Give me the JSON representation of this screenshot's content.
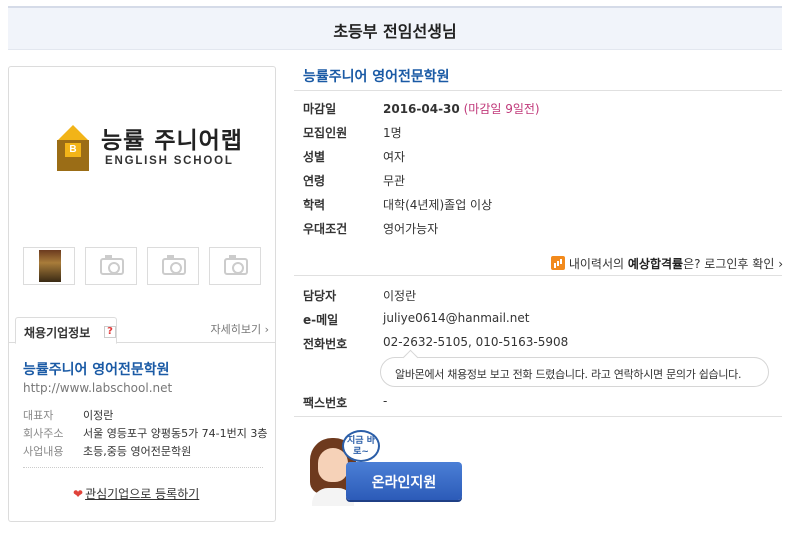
{
  "page_title": "초등부 전임선생님",
  "left": {
    "logo": {
      "kr": "능률 주니어랩",
      "en": "ENGLISH SCHOOL",
      "badge": "B"
    },
    "tab_label": "채용기업정보",
    "tab_help": "?",
    "detail_link": "자세히보기",
    "detail_arrow": "›",
    "company_name": "능률주니어 영어전문학원",
    "company_url": "http://www.labschool.net",
    "info": [
      {
        "key": "대표자",
        "value": "이정란"
      },
      {
        "key": "회사주소",
        "value": "서울 영등포구 양평동5가 74-1번지 3층"
      },
      {
        "key": "사업내용",
        "value": "초등,중등 영어전문학원"
      }
    ],
    "interest_heart": "❤",
    "interest_link": "관심기업으로 등록하기"
  },
  "right": {
    "title": "능률주니어 영어전문학원",
    "details": [
      {
        "key": "마감일",
        "value": "2016-04-30",
        "note": "(마감일 9일전)"
      },
      {
        "key": "모집인원",
        "value": "1명"
      },
      {
        "key": "성별",
        "value": "여자"
      },
      {
        "key": "연령",
        "value": "무관"
      },
      {
        "key": "학력",
        "value": "대학(4년제)졸업 이상"
      },
      {
        "key": "우대조건",
        "value": "영어가능자"
      }
    ],
    "estimate": {
      "prefix": "내이력서의",
      "strong": "예상합격률",
      "suffix": "은? 로그인후 확인",
      "arrow": "›"
    },
    "contacts": [
      {
        "key": "담당자",
        "value": "이정란"
      },
      {
        "key": "e-메일",
        "value": "juliye0614@hanmail.net"
      },
      {
        "key": "전화번호",
        "value": "02-2632-5105, 010-5163-5908"
      },
      {
        "key": "팩스번호",
        "value": "-"
      }
    ],
    "phone_tip": "알바몬에서 채용정보 보고 전화 드렸습니다. 라고 연락하시면 문의가 쉽습니다.",
    "apply": {
      "speech": "지금 바로~",
      "button": "온라인지원"
    }
  },
  "colors": {
    "accent_blue": "#1a5aa5",
    "deadline_pink": "#c0397a",
    "logo_yellow": "#f2b418",
    "logo_brown": "#9b6d16"
  },
  "icons": [
    "house-logo-icon",
    "camera-icon",
    "question-icon",
    "heart-icon",
    "chart-icon",
    "chevron-right-icon"
  ]
}
